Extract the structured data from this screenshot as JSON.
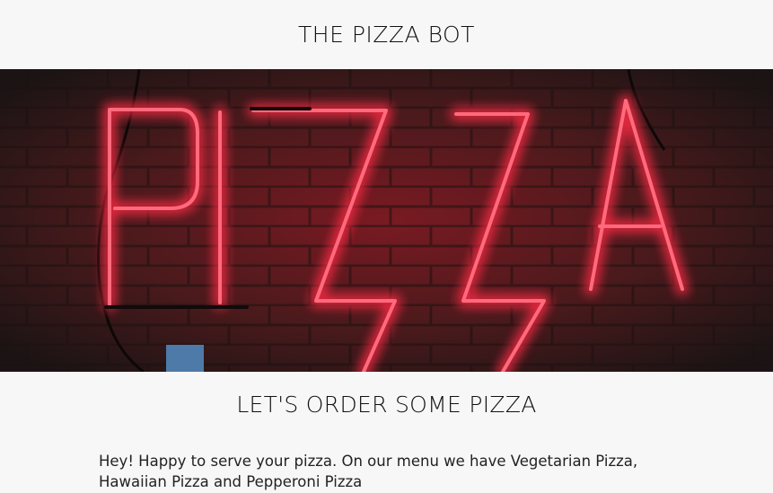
{
  "header": {
    "title": "THE PIZZA BOT"
  },
  "hero": {
    "sign_text": "PIZZA",
    "sign_color": "#ff1f3d"
  },
  "main": {
    "heading": "LET'S ORDER SOME PIZZA",
    "bot_message": "Hey! Happy to serve your pizza. On our menu we have Vegetarian Pizza, Hawaiian Pizza and Pepperoni Pizza"
  },
  "colors": {
    "background": "#f7f7f7",
    "text": "#111111",
    "brick": "#3a1c1f"
  }
}
